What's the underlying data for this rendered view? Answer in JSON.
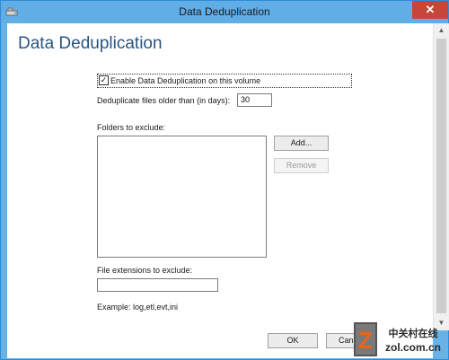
{
  "window": {
    "title": "Data Deduplication",
    "close_glyph": "✕"
  },
  "page": {
    "heading": "Data Deduplication"
  },
  "settings": {
    "enable_label": "Enable Data Deduplication on this volume",
    "enable_checked": true,
    "check_glyph": "✓",
    "days_label": "Deduplicate files older than (in days):",
    "days_value": "30",
    "folders_label": "Folders to exclude:",
    "folders": [],
    "add_button": "Add...",
    "remove_button": "Remove",
    "ext_label": "File extensions to exclude:",
    "ext_value": "",
    "example_text": "Example: log,etl,evt,ini"
  },
  "footer": {
    "ok_button": "OK",
    "cancel_button": "Cancel"
  },
  "scrollbar": {
    "up_glyph": "▲",
    "down_glyph": "▼"
  },
  "watermark": {
    "chinese": "中关村在线",
    "site": "zol.com.cn",
    "logo_letter": "Z"
  },
  "colors": {
    "titlebar": "#61ade6",
    "heading": "#2a5580",
    "close": "#c7463c",
    "accent_orange": "#e8641c"
  },
  "icons": {
    "title_icon": "drive-settings-icon",
    "close_icon": "close-icon",
    "check_icon": "checkmark-icon"
  }
}
